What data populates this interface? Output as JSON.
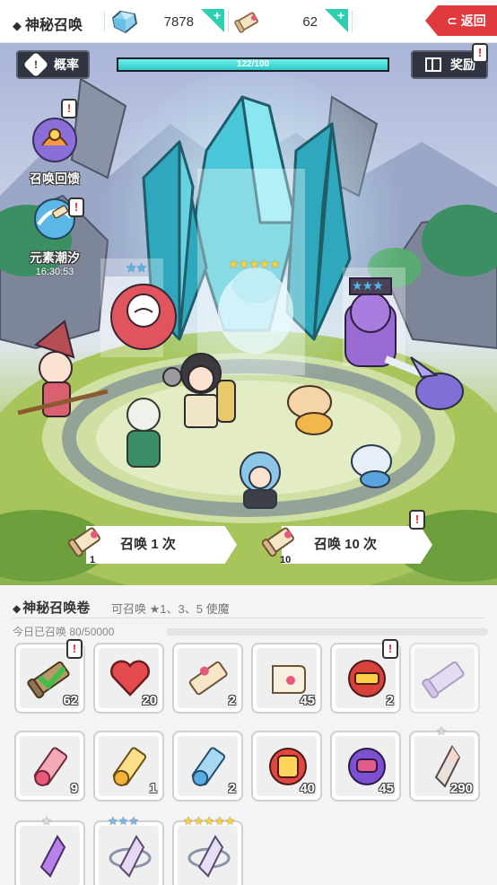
{
  "header": {
    "title": "神秘召唤",
    "gems": "7878",
    "scrolls": "62",
    "plus_gem": "+",
    "plus_scroll": "+",
    "back_label": "返回"
  },
  "scene": {
    "rate_label": "概率",
    "reward_label": "奖励",
    "progress_text": "122/100",
    "progress_ratio": 1.0,
    "side": [
      {
        "label": "召唤回馈",
        "time": ""
      },
      {
        "label": "元素潮汐",
        "time": "16:30:53"
      }
    ],
    "stars": {
      "left": "★★",
      "center": "★★★★★",
      "right": "★★★"
    },
    "summon_one": {
      "label": "召唤 1 次",
      "count": "1"
    },
    "summon_ten": {
      "label": "召唤 10 次",
      "count": "10"
    },
    "alert_mark": "!"
  },
  "panel": {
    "title": "神秘召唤卷",
    "subtitle": "可召唤 ★1、3、5 使魔",
    "today_count": "今日已召唤 80/50000",
    "items_row1": [
      "62",
      "20",
      "2",
      "45",
      "2",
      ""
    ],
    "items_row2": [
      "9",
      "1",
      "2",
      "40",
      "45",
      "290"
    ],
    "items_row3": [
      "",
      "",
      ""
    ]
  },
  "colors": {
    "accent": "#2ecfb1",
    "back_red": "#e03a3e",
    "progress": "#3fd8d6",
    "star_gold": "#ffd23a",
    "star_blue": "#55b4ea"
  }
}
